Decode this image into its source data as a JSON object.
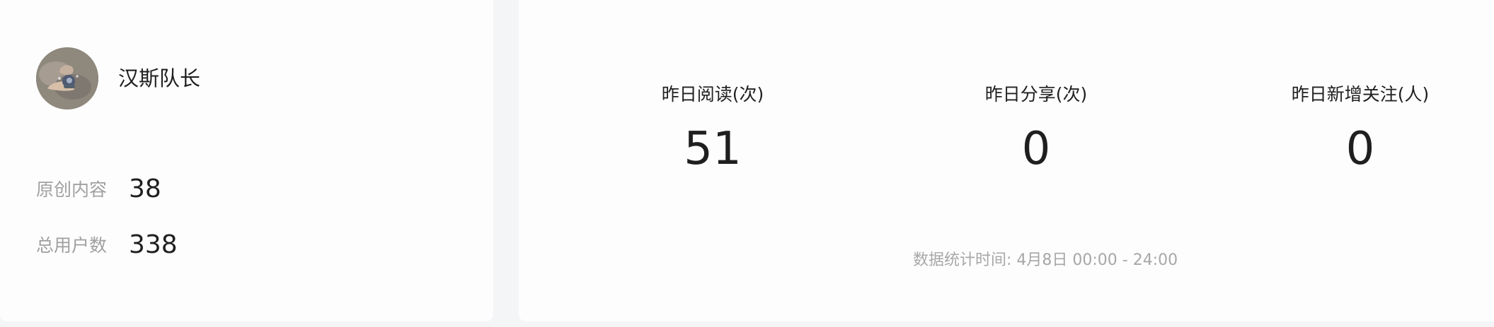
{
  "profile": {
    "name": "汉斯队长",
    "metrics": [
      {
        "label": "原创内容",
        "value": "38"
      },
      {
        "label": "总用户数",
        "value": "338"
      }
    ]
  },
  "stats": {
    "items": [
      {
        "label": "昨日阅读(次)",
        "value": "51"
      },
      {
        "label": "昨日分享(次)",
        "value": "0"
      },
      {
        "label": "昨日新增关注(人)",
        "value": "0"
      }
    ],
    "footer": "数据统计时间: 4月8日 00:00 - 24:00"
  },
  "colors": {
    "page_background": "#f4f5f7",
    "card_background": "#fdfdfd",
    "primary_text": "#1f1f1f",
    "muted_text": "#a0a0a0"
  },
  "icons": {
    "avatar": "user-photo-avatar"
  }
}
